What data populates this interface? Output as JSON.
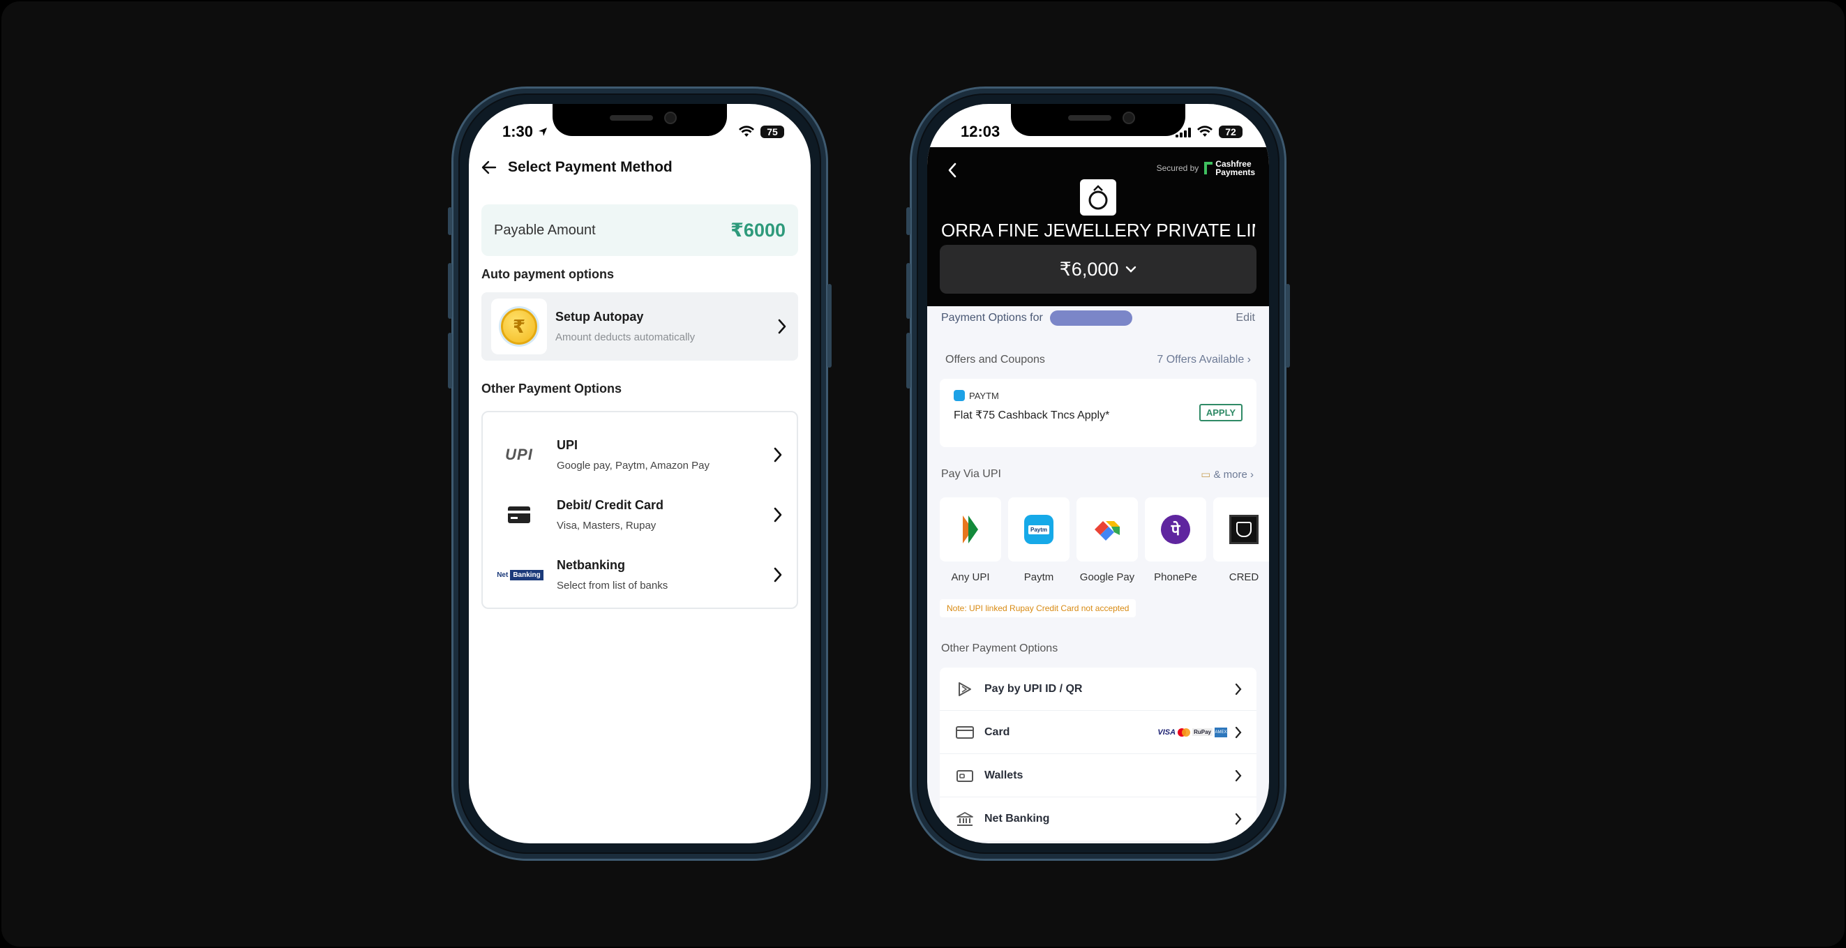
{
  "left_phone": {
    "status": {
      "time": "1:30",
      "battery": "75"
    },
    "header": {
      "title": "Select Payment Method"
    },
    "payable": {
      "label": "Payable Amount",
      "amount": "₹6000"
    },
    "auto_section": {
      "title": "Auto payment options",
      "autopay": {
        "title": "Setup Autopay",
        "subtitle": "Amount deducts automatically",
        "coin_symbol": "₹"
      }
    },
    "other_section": {
      "title": "Other Payment Options",
      "items": [
        {
          "title": "UPI",
          "subtitle": "Google pay, Paytm, Amazon Pay",
          "logo_text": "UPI"
        },
        {
          "title": "Debit/ Credit Card",
          "subtitle": "Visa, Masters, Rupay"
        },
        {
          "title": "Netbanking",
          "subtitle": "Select from list of banks",
          "logo_a": "Net",
          "logo_b": "Banking"
        }
      ]
    }
  },
  "right_phone": {
    "status": {
      "time": "12:03",
      "battery": "72"
    },
    "secured_by": "Secured by",
    "gateway_line1": "Cashfree",
    "gateway_line2": "Payments",
    "merchant_name": "ORRA FINE JEWELLERY PRIVATE LIMI...",
    "amount": "₹6,000",
    "payment_options_for": "Payment Options for",
    "edit": "Edit",
    "offers": {
      "title": "Offers and Coupons",
      "link": "7 Offers Available",
      "card": {
        "brand": "PAYTM",
        "text": "Flat ₹75 Cashback Tncs Apply*",
        "apply": "APPLY"
      }
    },
    "upi": {
      "title": "Pay Via UPI",
      "more": "& more",
      "apps": [
        {
          "label": "Any UPI"
        },
        {
          "label": "Paytm",
          "icon_text": "Paytm"
        },
        {
          "label": "Google Pay"
        },
        {
          "label": "PhonePe",
          "icon_text": "पे"
        },
        {
          "label": "CRED"
        }
      ],
      "note": "Note: UPI linked Rupay Credit Card not accepted"
    },
    "other": {
      "title": "Other Payment Options",
      "items": [
        {
          "label": "Pay by UPI ID / QR"
        },
        {
          "label": "Card",
          "brands": {
            "visa": "VISA",
            "rupay": "RuPay",
            "amex": "AMEX"
          }
        },
        {
          "label": "Wallets"
        },
        {
          "label": "Net Banking"
        }
      ]
    }
  }
}
